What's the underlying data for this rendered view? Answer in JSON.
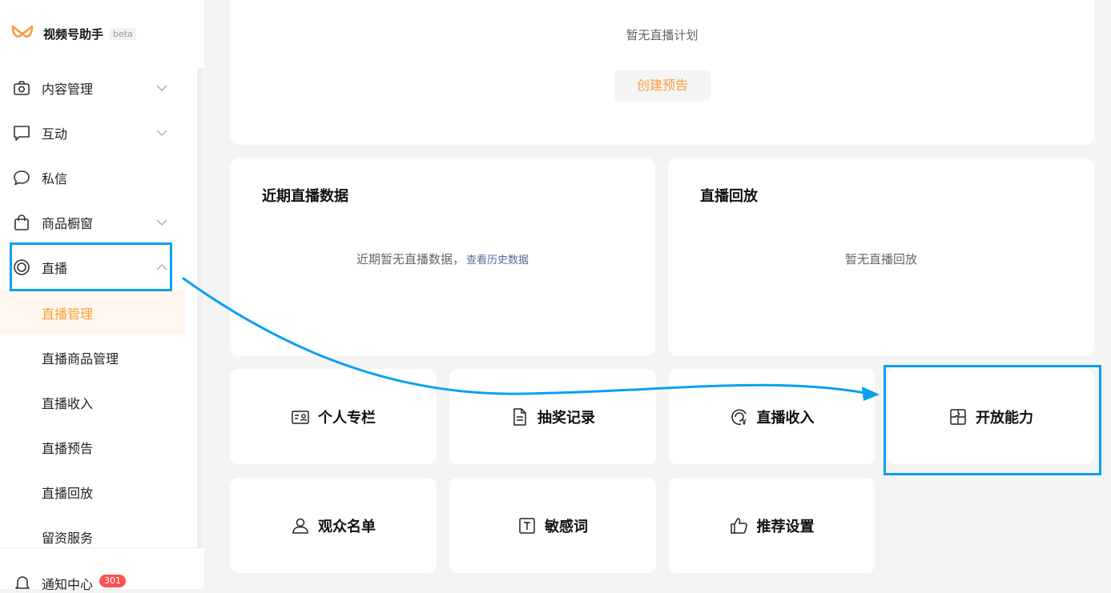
{
  "app": {
    "name": "视频号助手",
    "badge": "beta"
  },
  "sidebar": {
    "items": [
      {
        "label": "内容管理"
      },
      {
        "label": "互动"
      },
      {
        "label": "私信"
      },
      {
        "label": "商品橱窗"
      },
      {
        "label": "直播"
      }
    ],
    "live_sub": [
      {
        "label": "直播管理"
      },
      {
        "label": "直播商品管理"
      },
      {
        "label": "直播收入"
      },
      {
        "label": "直播预告"
      },
      {
        "label": "直播回放"
      },
      {
        "label": "留资服务"
      }
    ],
    "notice": {
      "label": "通知中心",
      "count": "301"
    }
  },
  "main": {
    "plan": {
      "empty_text": "暂无直播计划",
      "button": "创建预告"
    },
    "recent": {
      "title": "近期直播数据",
      "empty_text": "近期暂无直播数据，",
      "link": "查看历史数据"
    },
    "replay": {
      "title": "直播回放",
      "empty_text": "暂无直播回放"
    },
    "tiles": [
      {
        "label": "个人专栏",
        "icon": "profile-card-icon"
      },
      {
        "label": "抽奖记录",
        "icon": "document-icon"
      },
      {
        "label": "直播收入",
        "icon": "income-icon"
      },
      {
        "label": "开放能力",
        "icon": "puzzle-icon"
      },
      {
        "label": "观众名单",
        "icon": "user-icon"
      },
      {
        "label": "敏感词",
        "icon": "text-box-icon"
      },
      {
        "label": "推荐设置",
        "icon": "thumbs-up-icon"
      }
    ]
  },
  "colors": {
    "accent": "#fa9d3b",
    "highlight": "#0aa0f0",
    "badge": "#fa5151",
    "link": "#576b95"
  }
}
